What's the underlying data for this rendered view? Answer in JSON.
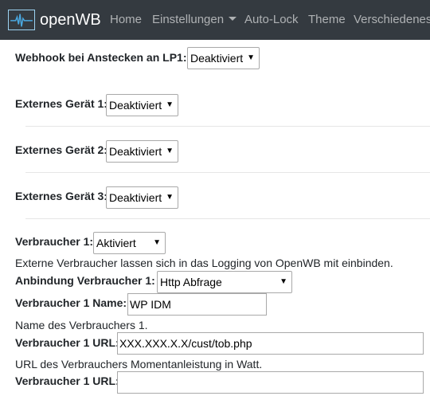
{
  "navbar": {
    "brand": "openWB",
    "items": [
      "Home",
      "Einstellungen",
      "Auto-Lock",
      "Theme",
      "Verschiedenes"
    ]
  },
  "webhook": {
    "label": "Webhook bei Anstecken an LP1:",
    "value": "Deaktiviert"
  },
  "externe_geraete": [
    {
      "label": "Externes Gerät 1:",
      "value": "Deaktiviert"
    },
    {
      "label": "Externes Gerät 2:",
      "value": "Deaktiviert"
    },
    {
      "label": "Externes Gerät 3:",
      "value": "Deaktiviert"
    }
  ],
  "verbraucher1": {
    "label": "Verbraucher 1:",
    "value": "Aktiviert",
    "help": "Externe Verbraucher lassen sich in das Logging von OpenWB mit einbinden.",
    "anbindung_label": "Anbindung Verbraucher 1:",
    "anbindung_value": "Http Abfrage",
    "name_label": "Verbraucher 1 Name:",
    "name_value": "WP IDM",
    "name_help": "Name des Verbrauchers 1.",
    "url_label": "Verbraucher 1 URL:",
    "url_value": "XXX.XXX.X.X/cust/tob.php",
    "url_help": "URL des Verbrauchers Momentanleistung in Watt.",
    "url2_label": "Verbraucher 1 URL:",
    "url2_value": ""
  },
  "colors": {
    "navbar_bg": "#343a40",
    "logo_accent": "#4aa8e0"
  }
}
